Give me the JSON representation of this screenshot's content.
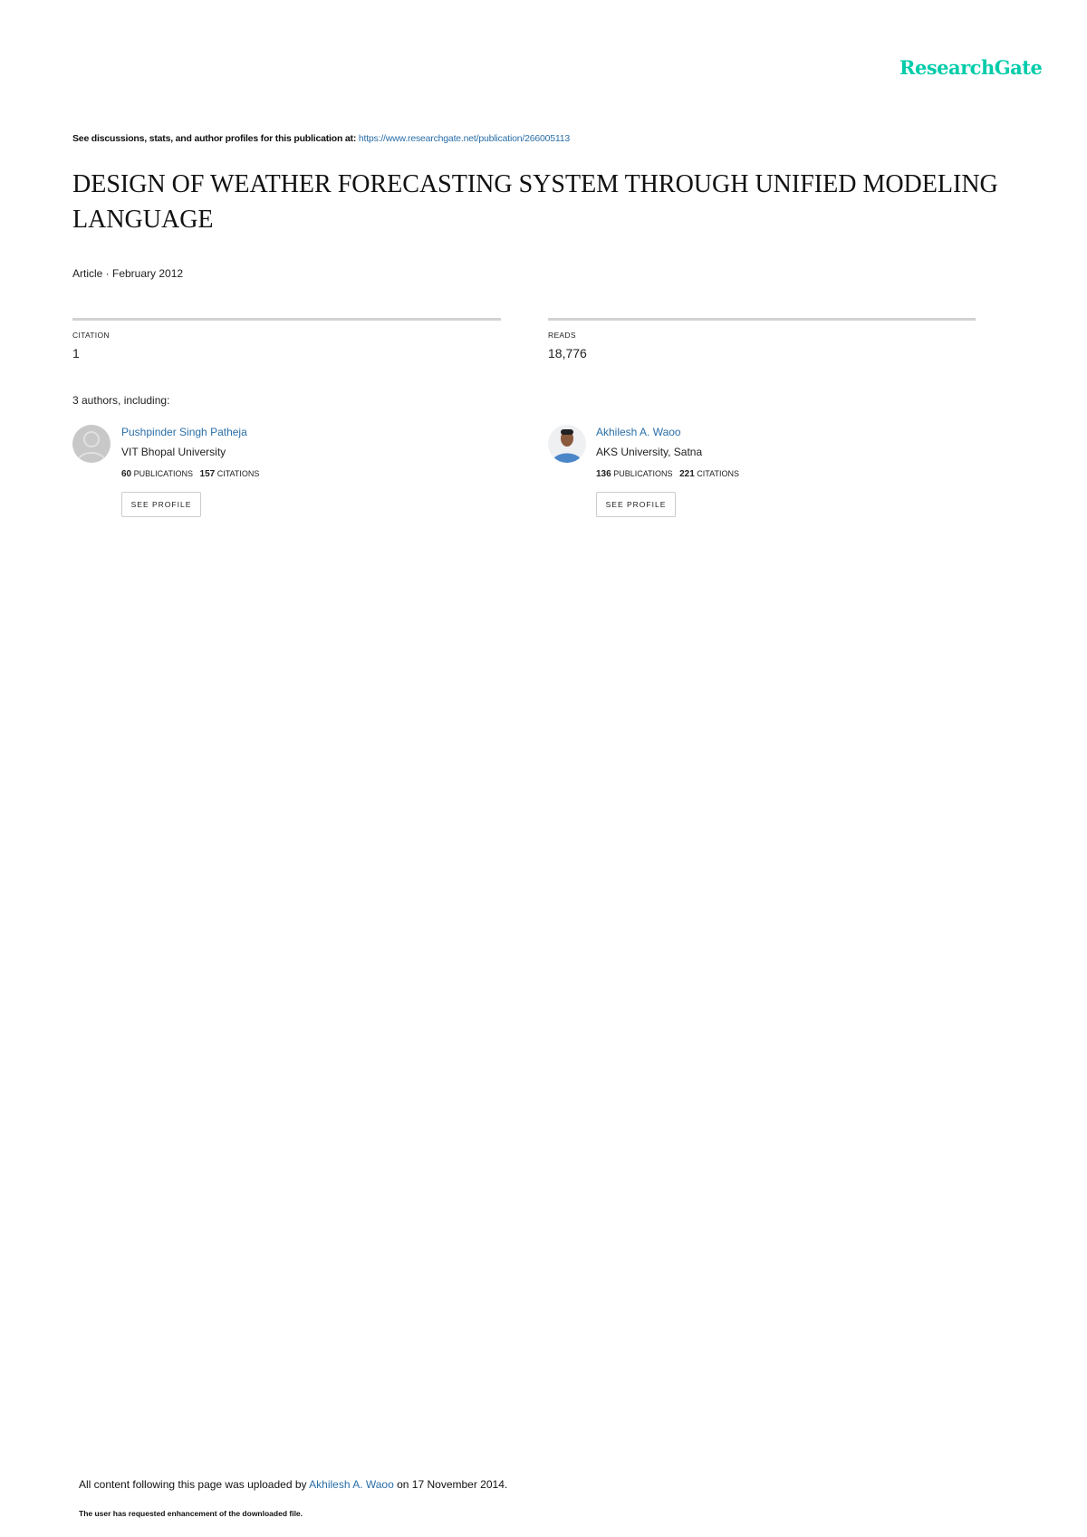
{
  "logo": "ResearchGate",
  "header": {
    "prefix": "See discussions, stats, and author profiles for this publication at: ",
    "url": "https://www.researchgate.net/publication/266005113"
  },
  "title": "DESIGN OF WEATHER FORECASTING SYSTEM THROUGH UNIFIED MODELING LANGUAGE",
  "meta": "Article · February 2012",
  "stats": {
    "citation_label": "CITATION",
    "citation_value": "1",
    "reads_label": "READS",
    "reads_value": "18,776"
  },
  "authors_heading": "3 authors, including:",
  "authors": [
    {
      "name": "Pushpinder Singh Patheja",
      "affiliation": "VIT Bhopal University",
      "publications": "60",
      "publications_label": "PUBLICATIONS",
      "citations": "157",
      "citations_label": "CITATIONS",
      "button": "SEE PROFILE"
    },
    {
      "name": "Akhilesh A. Waoo",
      "affiliation": "AKS University, Satna",
      "publications": "136",
      "publications_label": "PUBLICATIONS",
      "citations": "221",
      "citations_label": "CITATIONS",
      "button": "SEE PROFILE"
    }
  ],
  "footer": {
    "prefix": "All content following this page was uploaded by ",
    "uploader": "Akhilesh A. Waoo",
    "suffix": " on 17 November 2014.",
    "note": "The user has requested enhancement of the downloaded file."
  },
  "colors": {
    "brand": "#00ccaa",
    "link": "#2a6fa8"
  }
}
